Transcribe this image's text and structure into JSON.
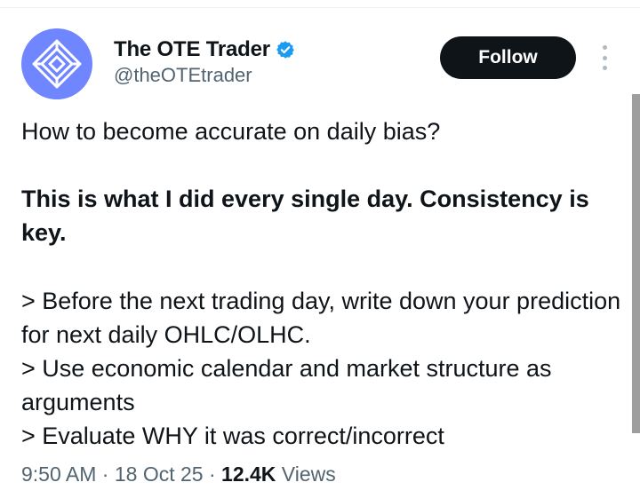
{
  "author": {
    "name": "The OTE Trader",
    "handle": "@theOTEtrader",
    "avatar_color": "#6f86ff",
    "verified_color": "#1d9bf0"
  },
  "actions": {
    "follow_label": "Follow",
    "more_icon": "more-vertical-icon"
  },
  "post": {
    "line1": "How to become accurate on daily bias?",
    "line2": "This is what I did every single day. Consistency is key.",
    "bullet1": "> Before the next trading day, write down your prediction for next daily OHLC/OLHC.",
    "bullet2": "> Use economic calendar and market structure as arguments",
    "bullet3": "> Evaluate WHY it was correct/incorrect"
  },
  "meta": {
    "time": "9:50 AM",
    "sep1": " · ",
    "date": "18 Oct 25",
    "sep2": " · ",
    "views_count": "12.4K",
    "views_label": " Views"
  }
}
